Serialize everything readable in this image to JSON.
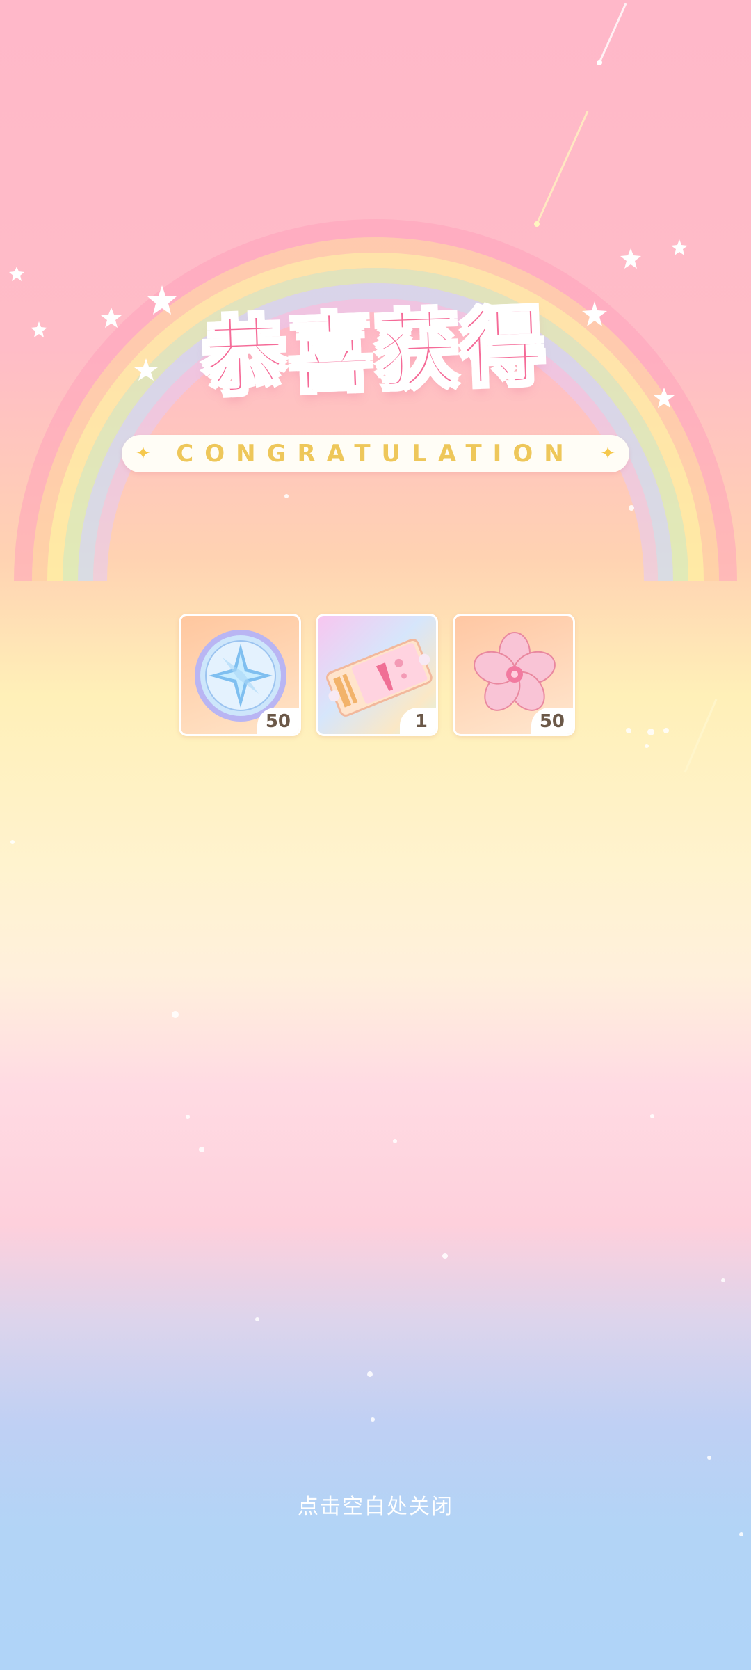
{
  "header": {
    "title": "恭喜获得",
    "subtitle": "CONGRATULATION"
  },
  "rewards": [
    {
      "icon": "star-compass-coin-icon",
      "count": "50"
    },
    {
      "icon": "ticket-icon",
      "count": "1"
    },
    {
      "icon": "sakura-flower-icon",
      "count": "50"
    }
  ],
  "footer": {
    "close_hint": "点击空白处关闭"
  },
  "colors": {
    "title": "#f56b98",
    "subtitle": "#eec75a",
    "count_text": "#6b5848"
  }
}
